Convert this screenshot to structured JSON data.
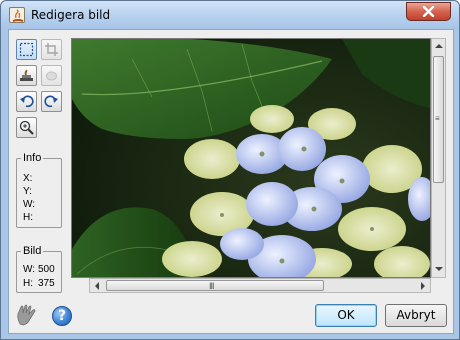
{
  "window": {
    "title": "Redigera bild"
  },
  "toolbar": {
    "tools": [
      {
        "name": "select-tool",
        "icon": "selection-rectangle-icon"
      },
      {
        "name": "crop-tool",
        "icon": "crop-icon"
      },
      {
        "name": "stamp-tool",
        "icon": "stamp-icon"
      },
      {
        "name": "mask-tool",
        "icon": "mask-icon"
      },
      {
        "name": "rotate-left",
        "icon": "rotate-left-icon"
      },
      {
        "name": "rotate-right",
        "icon": "rotate-right-icon"
      },
      {
        "name": "zoom-tool",
        "icon": "zoom-icon"
      }
    ]
  },
  "info": {
    "title": "Info",
    "x_label": "X:",
    "y_label": "Y:",
    "w_label": "W:",
    "h_label": "H:"
  },
  "bild": {
    "title": "Bild",
    "w_label": "W:",
    "w_value": "500",
    "h_label": "H:",
    "h_value": "375"
  },
  "scroll": {
    "h_grip": "III",
    "v_grip": "≡"
  },
  "buttons": {
    "ok": "OK",
    "cancel": "Avbryt"
  },
  "colors": {
    "title_bar": "#b6d0ee",
    "client_bg": "#eeeeee",
    "close_button": "#d4644f",
    "help_icon": "#3a7fd0"
  }
}
